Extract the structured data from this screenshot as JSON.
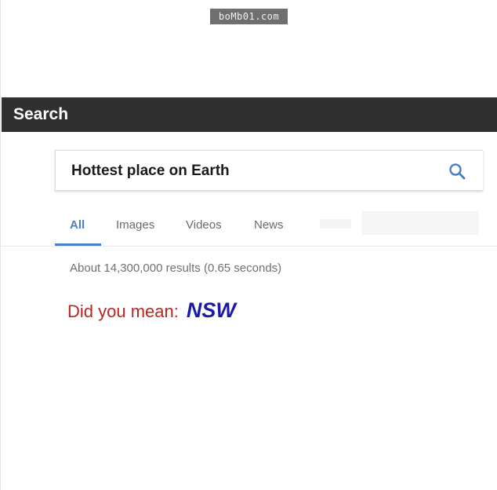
{
  "watermark": {
    "text": "boMb01.com"
  },
  "window": {
    "title": "Search"
  },
  "search": {
    "query": "Hottest place on Earth",
    "icon": "search-icon",
    "accent_color": "#4a7fc8"
  },
  "tabs": [
    {
      "label": "All",
      "active": true
    },
    {
      "label": "Images",
      "active": false
    },
    {
      "label": "Videos",
      "active": false
    },
    {
      "label": "News",
      "active": false
    }
  ],
  "results": {
    "stats": "About 14,300,000 results (0.65 seconds)"
  },
  "spelling": {
    "label": "Did you mean:",
    "suggestion": "NSW",
    "label_color": "#b8261e",
    "suggestion_color": "#1a1aa6"
  }
}
